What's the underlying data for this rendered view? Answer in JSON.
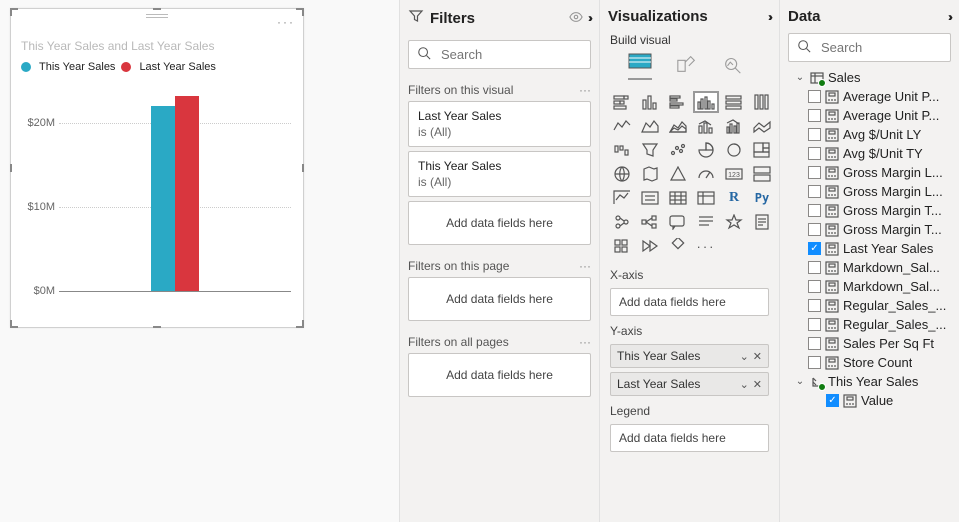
{
  "chart_data": {
    "type": "bar",
    "title": "This Year Sales and Last Year Sales",
    "series": [
      {
        "name": "This Year Sales",
        "color": "#2aa9c5",
        "values": [
          22000000
        ]
      },
      {
        "name": "Last Year Sales",
        "color": "#d9363e",
        "values": [
          23200000
        ]
      }
    ],
    "categories": [
      ""
    ],
    "ylabel": "",
    "ylim": [
      0,
      25000000
    ],
    "y_ticks": [
      0,
      10000000,
      20000000
    ],
    "y_tick_labels": [
      "$0M",
      "$10M",
      "$20M"
    ]
  },
  "visual_toolbar": {
    "filter_icon": "filter-icon",
    "focus_icon": "focus-icon",
    "more_icon": "more-icon"
  },
  "filters": {
    "title": "Filters",
    "search_placeholder": "Search",
    "sections": {
      "visual": {
        "label": "Filters on this visual",
        "applied": [
          {
            "field": "Last Year Sales",
            "summary": "is (All)"
          },
          {
            "field": "This Year Sales",
            "summary": "is (All)"
          }
        ],
        "drop_hint": "Add data fields here"
      },
      "page": {
        "label": "Filters on this page",
        "drop_hint": "Add data fields here"
      },
      "report": {
        "label": "Filters on all pages",
        "drop_hint": "Add data fields here"
      }
    }
  },
  "viz": {
    "title": "Visualizations",
    "subtitle": "Build visual",
    "wells": {
      "xaxis": {
        "label": "X-axis",
        "placeholder": "Add data fields here",
        "fields": []
      },
      "yaxis": {
        "label": "Y-axis",
        "fields": [
          "This Year Sales",
          "Last Year Sales"
        ]
      },
      "legend": {
        "label": "Legend",
        "placeholder": "Add data fields here",
        "fields": []
      }
    }
  },
  "data": {
    "title": "Data",
    "search_placeholder": "Search",
    "tables": [
      {
        "name": "Sales",
        "expanded": true,
        "columns": [
          {
            "name": "Average Unit P...",
            "type": "measure",
            "checked": false
          },
          {
            "name": "Average Unit P...",
            "type": "measure",
            "checked": false
          },
          {
            "name": "Avg $/Unit LY",
            "type": "measure",
            "checked": false
          },
          {
            "name": "Avg $/Unit TY",
            "type": "measure",
            "checked": false
          },
          {
            "name": "Gross Margin L...",
            "type": "measure",
            "checked": false
          },
          {
            "name": "Gross Margin L...",
            "type": "measure",
            "checked": false
          },
          {
            "name": "Gross Margin T...",
            "type": "measure",
            "checked": false
          },
          {
            "name": "Gross Margin T...",
            "type": "measure",
            "checked": false
          },
          {
            "name": "Last Year Sales",
            "type": "measure",
            "checked": true
          },
          {
            "name": "Markdown_Sal...",
            "type": "measure",
            "checked": false
          },
          {
            "name": "Markdown_Sal...",
            "type": "measure",
            "checked": false
          },
          {
            "name": "Regular_Sales_...",
            "type": "measure",
            "checked": false
          },
          {
            "name": "Regular_Sales_...",
            "type": "measure",
            "checked": false
          },
          {
            "name": "Sales Per Sq Ft",
            "type": "measure",
            "checked": false
          },
          {
            "name": "Store Count",
            "type": "measure",
            "checked": false
          }
        ]
      },
      {
        "name": "This Year Sales",
        "expanded": true,
        "is_hierarchy": true,
        "columns": [
          {
            "name": "Value",
            "type": "measure",
            "checked": true
          }
        ]
      }
    ]
  }
}
